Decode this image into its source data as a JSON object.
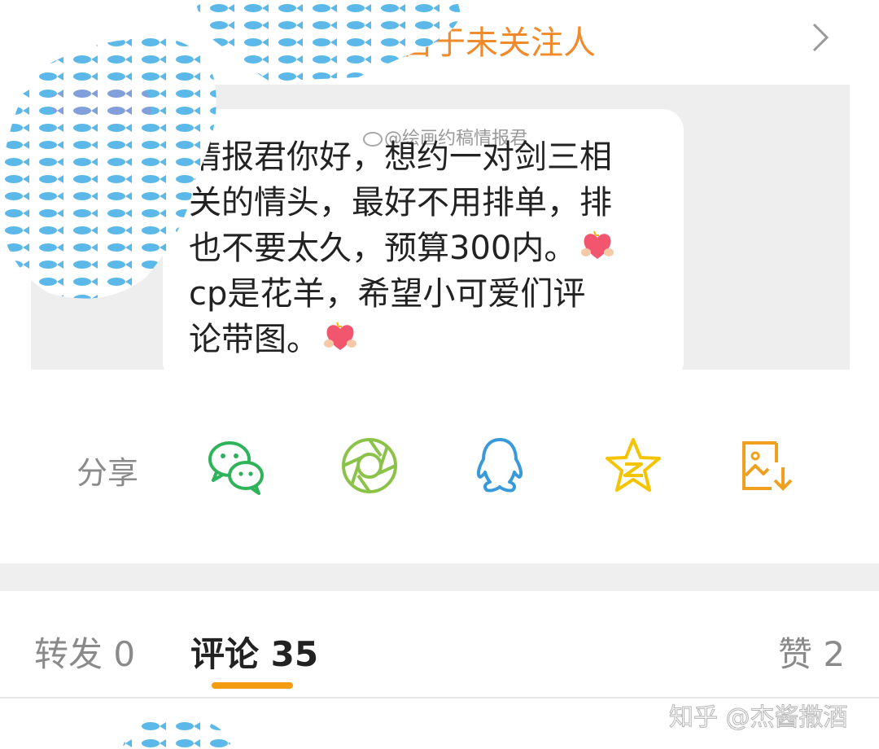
{
  "header": {
    "partial_label": "来自于未关注人"
  },
  "quote": {
    "watermark": "@绘画约稿情报君",
    "message_lines": [
      "情报君你好，想约一对剑三相",
      "关的情头，最好不用排单，排",
      "也不要太久，预算300内。",
      "cp是花羊，希望小可爱们评",
      "论带图。"
    ]
  },
  "share": {
    "label": "分享",
    "icons": [
      "wechat-icon",
      "moments-icon",
      "qq-icon",
      "qzone-icon",
      "save-image-icon"
    ]
  },
  "tabs": {
    "repost": "转发 0",
    "comments": "评论 35",
    "likes": "赞 2"
  },
  "footer": {
    "watermark": "知乎 @杰酱撒酒"
  },
  "colors": {
    "accent": "#f39c12",
    "label_orange": "#f08a2a",
    "wechat_green": "#2fb35a",
    "moments_green": "#8bc34a",
    "qq_blue": "#3a9ad9",
    "star_yellow": "#f5c400",
    "save_orange": "#f0a020"
  }
}
